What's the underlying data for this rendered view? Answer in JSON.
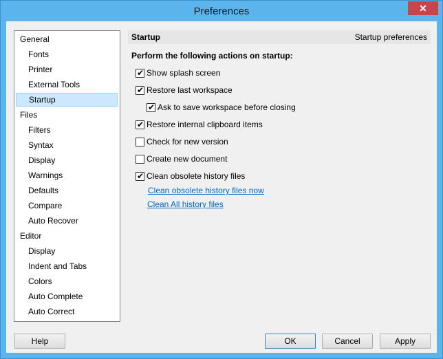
{
  "window": {
    "title": "Preferences",
    "close_glyph": "✕"
  },
  "tree": {
    "items": [
      {
        "label": "General",
        "level": 0
      },
      {
        "label": "Fonts",
        "level": 1
      },
      {
        "label": "Printer",
        "level": 1
      },
      {
        "label": "External Tools",
        "level": 1
      },
      {
        "label": "Startup",
        "level": 1,
        "selected": true
      },
      {
        "label": "Files",
        "level": 0
      },
      {
        "label": "Filters",
        "level": 1
      },
      {
        "label": "Syntax",
        "level": 1
      },
      {
        "label": "Display",
        "level": 1
      },
      {
        "label": "Warnings",
        "level": 1
      },
      {
        "label": "Defaults",
        "level": 1
      },
      {
        "label": "Compare",
        "level": 1
      },
      {
        "label": "Auto Recover",
        "level": 1
      },
      {
        "label": "Editor",
        "level": 0
      },
      {
        "label": "Display",
        "level": 1
      },
      {
        "label": "Indent and Tabs",
        "level": 1
      },
      {
        "label": "Colors",
        "level": 1
      },
      {
        "label": "Auto Complete",
        "level": 1
      },
      {
        "label": "Auto Correct",
        "level": 1
      }
    ]
  },
  "panel": {
    "header_title": "Startup",
    "header_subtitle": "Startup preferences",
    "section_heading": "Perform the following actions on startup:",
    "options": [
      {
        "label": "Show splash screen",
        "checked": true,
        "indent": 0
      },
      {
        "label": "Restore last workspace",
        "checked": true,
        "indent": 0
      },
      {
        "label": "Ask to save workspace before closing",
        "checked": true,
        "indent": 1
      },
      {
        "label": "Restore internal clipboard items",
        "checked": true,
        "indent": 0
      },
      {
        "label": "Check for new version",
        "checked": false,
        "indent": 0
      },
      {
        "label": "Create new document",
        "checked": false,
        "indent": 0
      },
      {
        "label": "Clean obsolete history files",
        "checked": true,
        "indent": 0
      }
    ],
    "links": [
      "Clean obsolete history files now",
      "Clean All history files"
    ]
  },
  "buttons": {
    "help": "Help",
    "ok": "OK",
    "cancel": "Cancel",
    "apply": "Apply"
  },
  "colors": {
    "titlebar": "#5bb5ec",
    "selection": "#cce8ff",
    "link": "#0066cc",
    "close": "#c7464a"
  }
}
